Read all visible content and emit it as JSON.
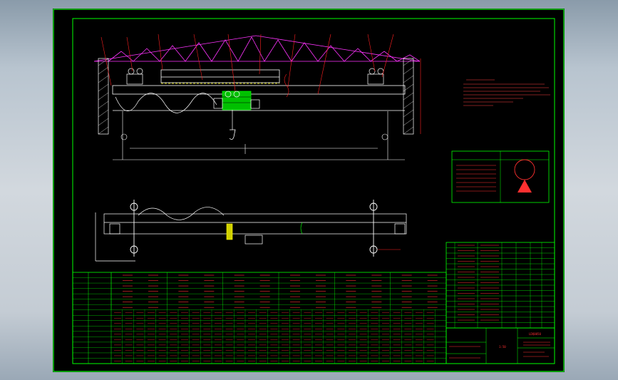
{
  "viewport": {
    "background": "#b8c4cf"
  },
  "sheet": {
    "background": "#000000",
    "border_color": "#00ff00"
  },
  "colors": {
    "structure": "#ffffff",
    "roof_truss": "#ff33ff",
    "leader": "#ff2020",
    "dimension": "#ffffff",
    "table_grid": "#00ff00",
    "hoist": "#00dd00",
    "stamp": "#ff3030",
    "notes_text": "#ff4040",
    "guide_rail": "#ffff00",
    "hatch": "#ffffff"
  },
  "title_block": {
    "drawing_number": "LDQ0050",
    "scale_label": "1:50"
  }
}
